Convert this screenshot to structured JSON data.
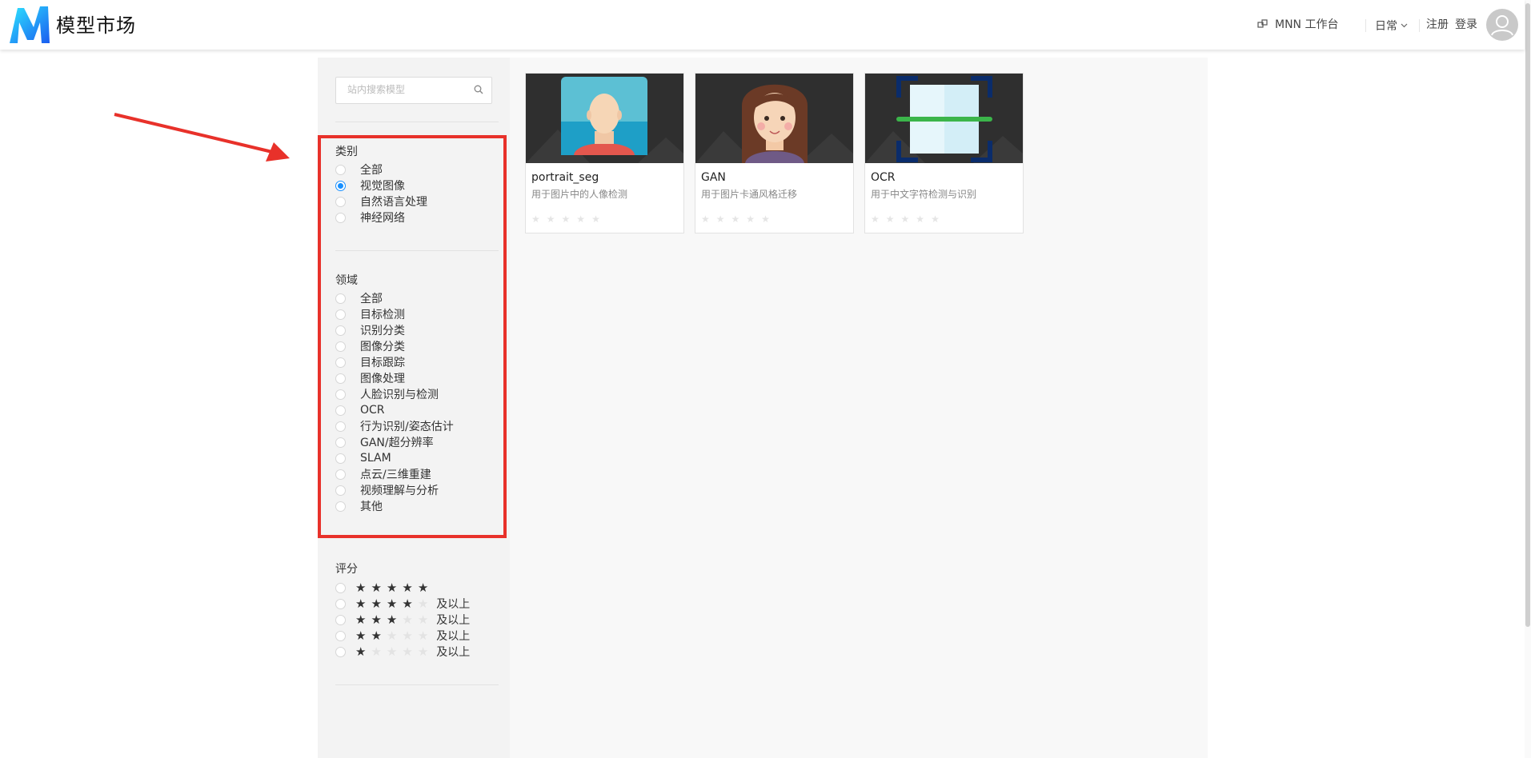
{
  "header": {
    "app_title": "模型市场",
    "workbench_label": "MNN 工作台",
    "env_label": "日常",
    "register_label": "注册",
    "login_label": "登录"
  },
  "sidebar": {
    "search_placeholder": "站内搜索模型",
    "category": {
      "title": "类别",
      "options": [
        {
          "label": "全部",
          "checked": false
        },
        {
          "label": "视觉图像",
          "checked": true
        },
        {
          "label": "自然语言处理",
          "checked": false
        },
        {
          "label": "神经网络",
          "checked": false
        }
      ]
    },
    "domain": {
      "title": "领域",
      "options": [
        "全部",
        "目标检测",
        "识别分类",
        "图像分类",
        "目标跟踪",
        "图像处理",
        "人脸识别与检测",
        "OCR",
        "行为识别/姿态估计",
        "GAN/超分辨率",
        "SLAM",
        "点云/三维重建",
        "视频理解与分析",
        "其他"
      ]
    },
    "rating": {
      "title": "评分",
      "options": [
        {
          "stars": 5,
          "suffix": ""
        },
        {
          "stars": 4,
          "suffix": "及以上"
        },
        {
          "stars": 3,
          "suffix": "及以上"
        },
        {
          "stars": 2,
          "suffix": "及以上"
        },
        {
          "stars": 1,
          "suffix": "及以上"
        }
      ]
    }
  },
  "models": [
    {
      "title": "portrait_seg",
      "desc": "用于图片中的人像检测",
      "rating": 0
    },
    {
      "title": "GAN",
      "desc": "用于图片卡通风格迁移",
      "rating": 0
    },
    {
      "title": "OCR",
      "desc": "用于中文字符检测与识别",
      "rating": 0
    }
  ],
  "colors": {
    "accent": "#1890ff",
    "highlight": "#e8312a",
    "logo_blue": "#1a7cf5"
  }
}
